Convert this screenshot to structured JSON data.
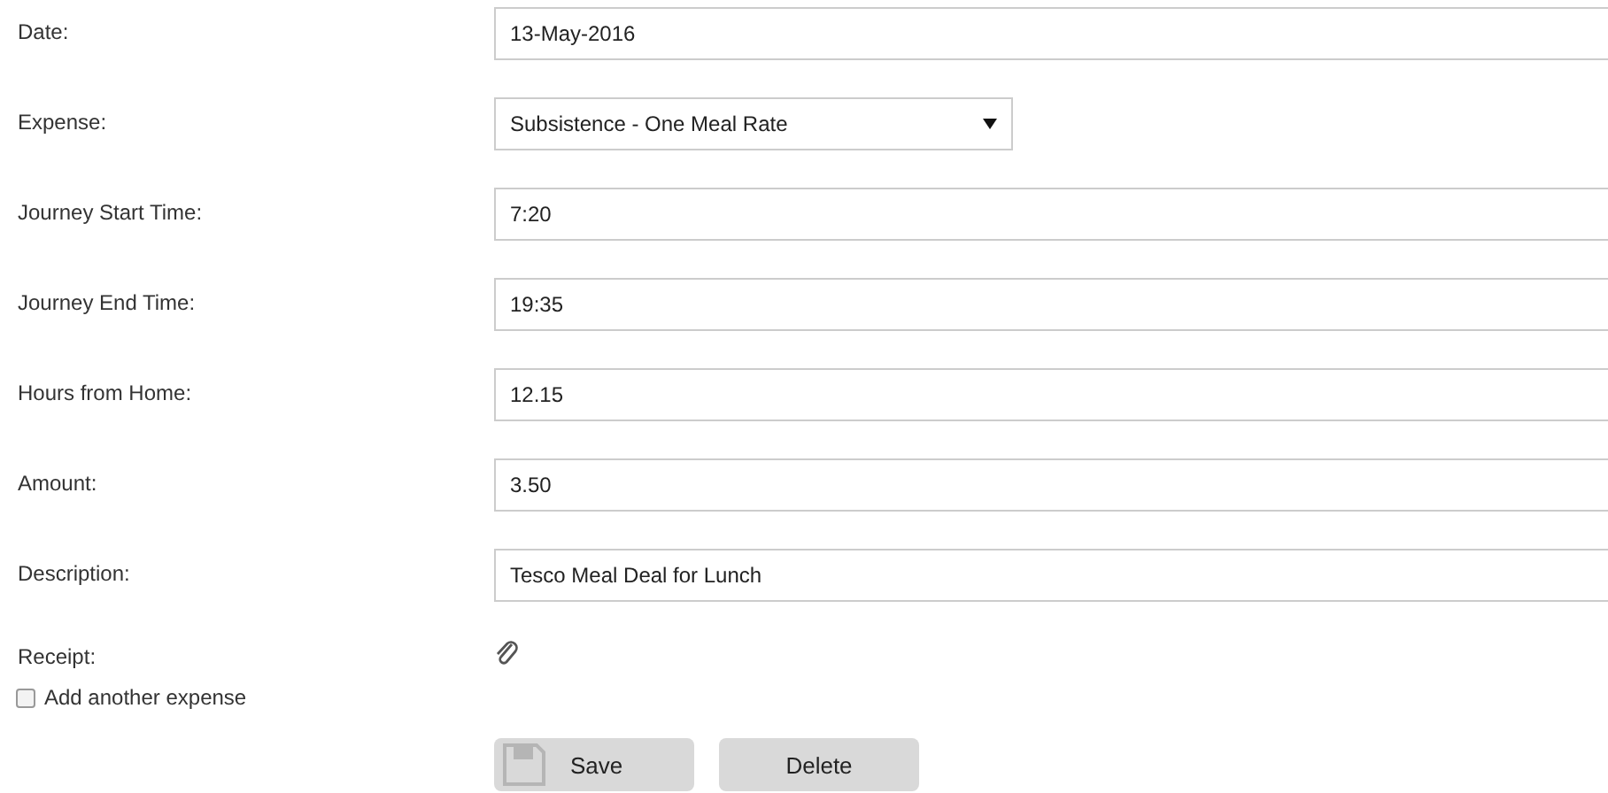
{
  "fields": [
    {
      "label": "Date:",
      "kind": "text",
      "value": "13-May-2016"
    },
    {
      "label": "Expense:",
      "kind": "select",
      "value": "Subsistence - One Meal Rate"
    },
    {
      "label": "Journey Start Time:",
      "kind": "text",
      "value": "7:20"
    },
    {
      "label": "Journey End Time:",
      "kind": "text",
      "value": "19:35"
    },
    {
      "label": "Hours from Home:",
      "kind": "text",
      "value": "12.15"
    },
    {
      "label": "Amount:",
      "kind": "text",
      "value": "3.50"
    },
    {
      "label": "Description:",
      "kind": "text",
      "value": "Tesco Meal Deal for Lunch"
    },
    {
      "label": "Receipt:",
      "kind": "attachment"
    }
  ],
  "add_another": {
    "label": "Add another expense",
    "checked": false
  },
  "buttons": [
    {
      "label": "Save",
      "kind": "save"
    },
    {
      "label": "Delete",
      "kind": "plain"
    }
  ]
}
